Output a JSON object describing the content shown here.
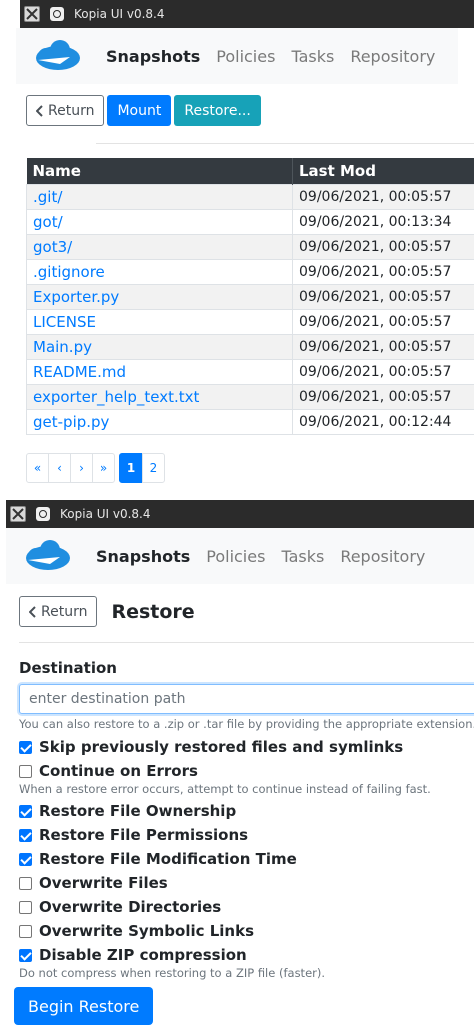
{
  "window": {
    "title": "Kopia UI v0.8.4"
  },
  "nav": {
    "items": [
      "Snapshots",
      "Policies",
      "Tasks",
      "Repository"
    ],
    "active": "Snapshots"
  },
  "browse": {
    "buttons": {
      "return": "Return",
      "mount": "Mount",
      "restore": "Restore..."
    },
    "columns": [
      "Name",
      "Last Mod"
    ],
    "rows": [
      {
        "name": ".git/",
        "last_mod": "09/06/2021, 00:05:57"
      },
      {
        "name": "got/",
        "last_mod": "09/06/2021, 00:13:34"
      },
      {
        "name": "got3/",
        "last_mod": "09/06/2021, 00:05:57"
      },
      {
        "name": ".gitignore",
        "last_mod": "09/06/2021, 00:05:57"
      },
      {
        "name": "Exporter.py",
        "last_mod": "09/06/2021, 00:05:57"
      },
      {
        "name": "LICENSE",
        "last_mod": "09/06/2021, 00:05:57"
      },
      {
        "name": "Main.py",
        "last_mod": "09/06/2021, 00:05:57"
      },
      {
        "name": "README.md",
        "last_mod": "09/06/2021, 00:05:57"
      },
      {
        "name": "exporter_help_text.txt",
        "last_mod": "09/06/2021, 00:05:57"
      },
      {
        "name": "get-pip.py",
        "last_mod": "09/06/2021, 00:12:44"
      }
    ],
    "pagination": {
      "first": "«",
      "prev": "‹",
      "next": "›",
      "last": "»",
      "pages": [
        "1",
        "2"
      ],
      "current": "1"
    }
  },
  "restore": {
    "return": "Return",
    "title": "Restore",
    "destination_label": "Destination",
    "destination_placeholder": "enter destination path",
    "destination_value": "",
    "destination_hint": "You can also restore to a .zip or .tar file by providing the appropriate extension.",
    "options": [
      {
        "label": "Skip previously restored files and symlinks",
        "checked": true
      },
      {
        "label": "Continue on Errors",
        "checked": false,
        "hint": "When a restore error occurs, attempt to continue instead of failing fast."
      },
      {
        "label": "Restore File Ownership",
        "checked": true
      },
      {
        "label": "Restore File Permissions",
        "checked": true
      },
      {
        "label": "Restore File Modification Time",
        "checked": true
      },
      {
        "label": "Overwrite Files",
        "checked": false
      },
      {
        "label": "Overwrite Directories",
        "checked": false
      },
      {
        "label": "Overwrite Symbolic Links",
        "checked": false
      },
      {
        "label": "Disable ZIP compression",
        "checked": true,
        "hint": "Do not compress when restoring to a ZIP file (faster)."
      }
    ],
    "submit": "Begin Restore"
  },
  "colors": {
    "primary": "#007bff",
    "info": "#17a2b8",
    "dark": "#343a40",
    "titlebar": "#2b2b2b"
  }
}
